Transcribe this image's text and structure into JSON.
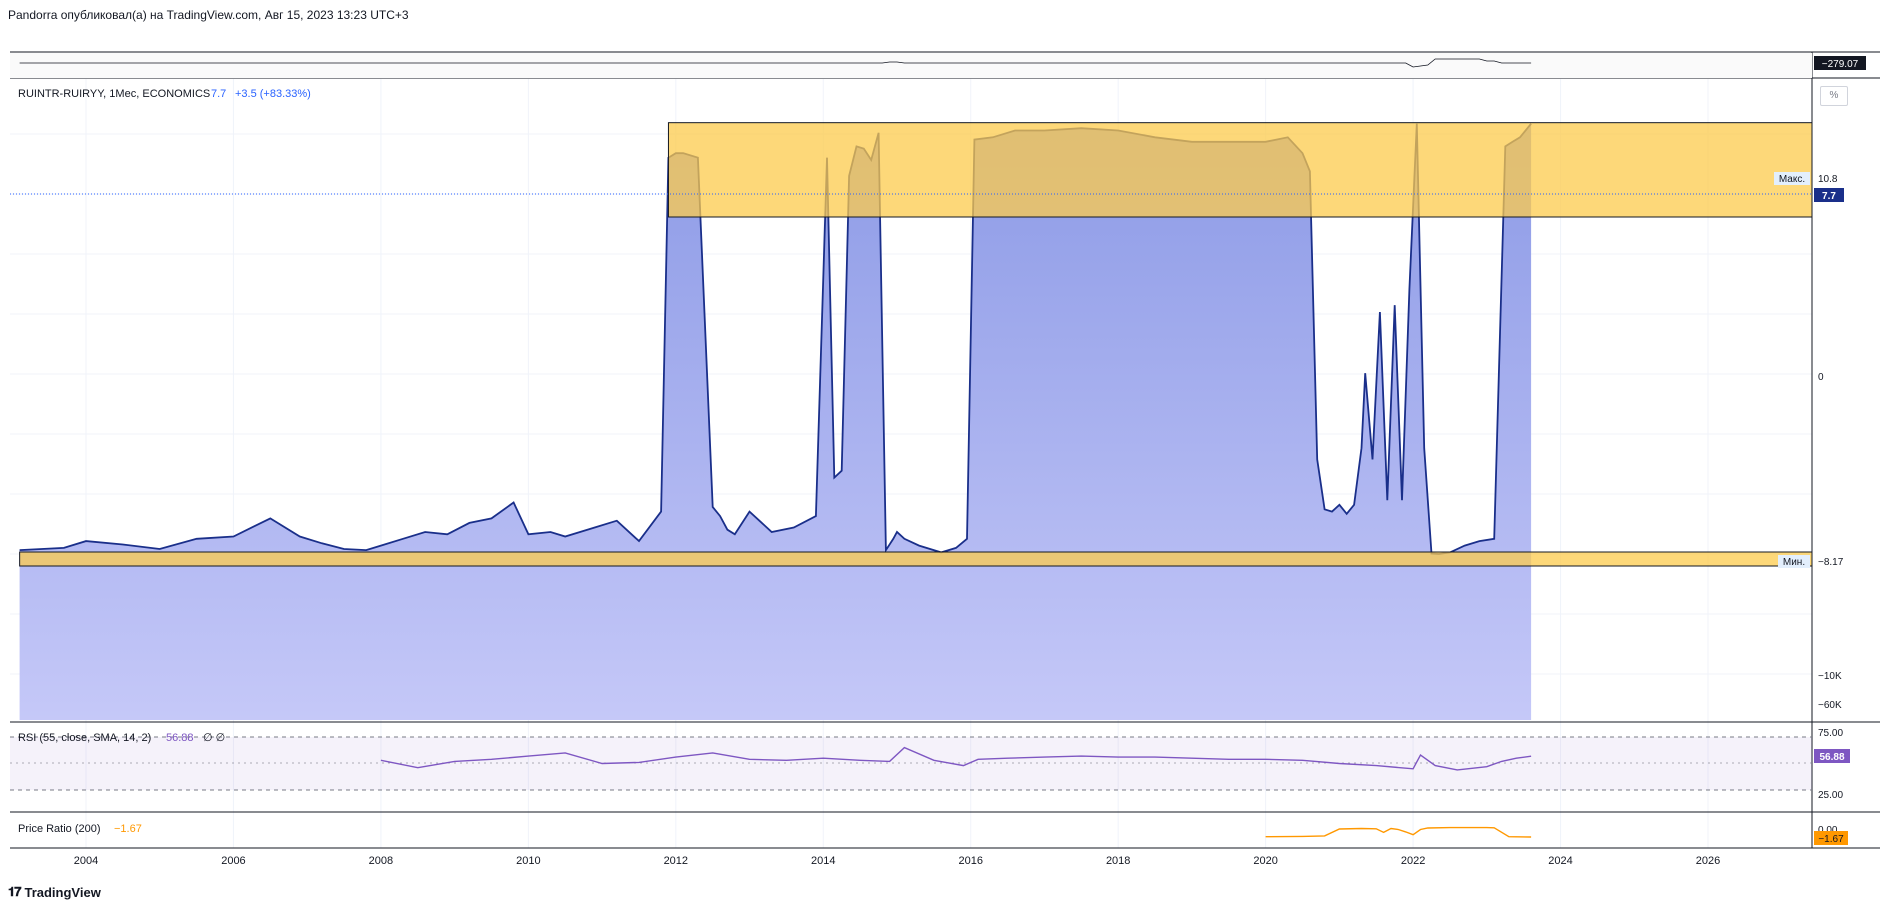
{
  "header": {
    "publisher_text": "Pandorra опубликовал(а) на TradingView.com, Авг 15, 2023 13:23 UTC+3"
  },
  "footer": {
    "logo_icon": "tradingview-logo-icon",
    "brand": "TradingView"
  },
  "main_pane": {
    "symbol": "RUINTR-RUIRYY, 1Мес, ECONOMICS",
    "last_value": "7.7",
    "change": "+3.5 (+83.33%)",
    "percent_button": "%",
    "max_label": "Макс.",
    "max_value": "10.8",
    "min_label": "Мин.",
    "min_value": "−8.17",
    "last_value_tag": "7.7",
    "y_axis_labels": [
      "0",
      "−10K",
      "−60K"
    ],
    "line_color": "#1a2f8a",
    "fill_color": "#8c9ae6",
    "zone_color": "#fccb4c"
  },
  "top_pane": {
    "value_tag": "−279.07"
  },
  "rsi_pane": {
    "legend_name": "RSI (55, close, SMA, 14, 2)",
    "legend_value": "56.88",
    "legend_extra": "∅ ∅",
    "value_tag": "56.88",
    "y_axis_labels": [
      "75.00",
      "25.00"
    ],
    "line_color": "#7e57c2"
  },
  "price_ratio_pane": {
    "legend_name": "Price Ratio (200)",
    "legend_value": "−1.67",
    "value_tag": "−1.67",
    "y_axis_labels": [
      "0.00"
    ],
    "line_color": "#ff9800"
  },
  "x_axis": {
    "ticks": [
      "2004",
      "2006",
      "2008",
      "2010",
      "2012",
      "2014",
      "2016",
      "2018",
      "2020",
      "2022",
      "2024",
      "2026"
    ]
  },
  "chart_data": [
    {
      "type": "area",
      "x": [
        2003.1,
        2003.4,
        2003.7,
        2004.0,
        2004.5,
        2005.0,
        2005.5,
        2006.0,
        2006.5,
        2006.9,
        2007.2,
        2007.5,
        2007.8,
        2008.0,
        2008.3,
        2008.6,
        2008.9,
        2009.2,
        2009.5,
        2009.8,
        2010.0,
        2010.3,
        2010.5,
        2010.7,
        2010.9,
        2011.2,
        2011.5,
        2011.8,
        2011.9,
        2012.0,
        2012.1,
        2012.3,
        2012.5,
        2012.6,
        2012.7,
        2012.8,
        2013.0,
        2013.3,
        2013.6,
        2013.9,
        2014.05,
        2014.15,
        2014.25,
        2014.35,
        2014.45,
        2014.55,
        2014.65,
        2014.75,
        2014.85,
        2014.95,
        2015.0,
        2015.1,
        2015.3,
        2015.6,
        2015.8,
        2015.95,
        2016.05,
        2016.3,
        2016.6,
        2017.0,
        2017.5,
        2018.0,
        2018.5,
        2019.0,
        2019.5,
        2020.0,
        2020.3,
        2020.5,
        2020.6,
        2020.7,
        2020.8,
        2020.9,
        2021.0,
        2021.1,
        2021.2,
        2021.3,
        2021.35,
        2021.45,
        2021.55,
        2021.65,
        2021.75,
        2021.85,
        2021.95,
        2022.05,
        2022.15,
        2022.25,
        2022.35,
        2022.5,
        2022.7,
        2022.9,
        2023.1,
        2023.25,
        2023.35,
        2023.45,
        2023.6
      ],
      "values": [
        -8.0,
        -7.95,
        -7.9,
        -7.6,
        -7.75,
        -7.95,
        -7.5,
        -7.4,
        -6.6,
        -7.4,
        -7.7,
        -7.95,
        -8.0,
        -7.8,
        -7.5,
        -7.2,
        -7.3,
        -6.8,
        -6.6,
        -5.9,
        -7.3,
        -7.2,
        -7.4,
        -7.2,
        -7.0,
        -6.7,
        -7.6,
        -6.3,
        9.3,
        9.5,
        9.5,
        9.3,
        -6.1,
        -6.5,
        -7.1,
        -7.3,
        -6.3,
        -7.2,
        -7.0,
        -6.5,
        9.3,
        -4.8,
        -4.5,
        8.5,
        9.8,
        9.7,
        9.2,
        10.4,
        -8.0,
        -7.5,
        -7.2,
        -7.5,
        -7.8,
        -8.1,
        -7.9,
        -7.5,
        10.1,
        10.2,
        10.5,
        10.5,
        10.6,
        10.5,
        10.2,
        10.0,
        10.0,
        10.0,
        10.2,
        9.5,
        8.7,
        -4.0,
        -6.2,
        -6.3,
        -6.0,
        -6.4,
        -6.0,
        -3.5,
        -0.2,
        -4.0,
        2.5,
        -5.8,
        2.8,
        -5.8,
        3.5,
        10.8,
        -3.5,
        -8.15,
        -8.17,
        -8.1,
        -7.8,
        -7.6,
        -7.5,
        9.8,
        10.0,
        10.2,
        10.8,
        7.7
      ],
      "max": 10.8,
      "min": -8.17,
      "last": 7.7
    },
    {
      "type": "line",
      "x": [
        2008.0,
        2008.5,
        2009.0,
        2009.5,
        2010.0,
        2010.5,
        2011.0,
        2011.5,
        2012.0,
        2012.5,
        2013.0,
        2013.5,
        2014.0,
        2014.5,
        2014.9,
        2015.1,
        2015.5,
        2015.9,
        2016.1,
        2016.5,
        2017.0,
        2017.5,
        2018.0,
        2018.5,
        2019.0,
        2019.5,
        2020.0,
        2020.5,
        2021.0,
        2021.5,
        2022.0,
        2022.1,
        2022.3,
        2022.6,
        2023.0,
        2023.2,
        2023.4,
        2023.6
      ],
      "values": [
        53,
        46,
        52,
        54,
        57,
        60,
        50,
        51,
        56,
        60,
        54,
        53,
        55,
        53,
        52,
        65,
        53,
        48,
        54,
        55,
        56,
        57,
        56,
        56,
        55,
        54,
        54,
        53,
        50,
        48,
        45,
        58,
        48,
        44,
        47,
        52,
        55,
        56.88
      ],
      "ylim": [
        0,
        100
      ]
    },
    {
      "type": "line",
      "x": [
        2020.0,
        2020.5,
        2020.8,
        2021.0,
        2021.3,
        2021.5,
        2021.6,
        2021.7,
        2021.8,
        2021.9,
        2022.0,
        2022.1,
        2022.2,
        2022.5,
        2023.0,
        2023.1,
        2023.3,
        2023.6
      ],
      "values": [
        -1.6,
        -1.55,
        -1.45,
        0.0,
        0.1,
        0.05,
        -0.7,
        0.1,
        -0.1,
        -0.6,
        -1.2,
        -0.1,
        0.2,
        0.3,
        0.3,
        0.25,
        -1.6,
        -1.67
      ],
      "ylim": [
        -2.0,
        0.5
      ]
    }
  ]
}
